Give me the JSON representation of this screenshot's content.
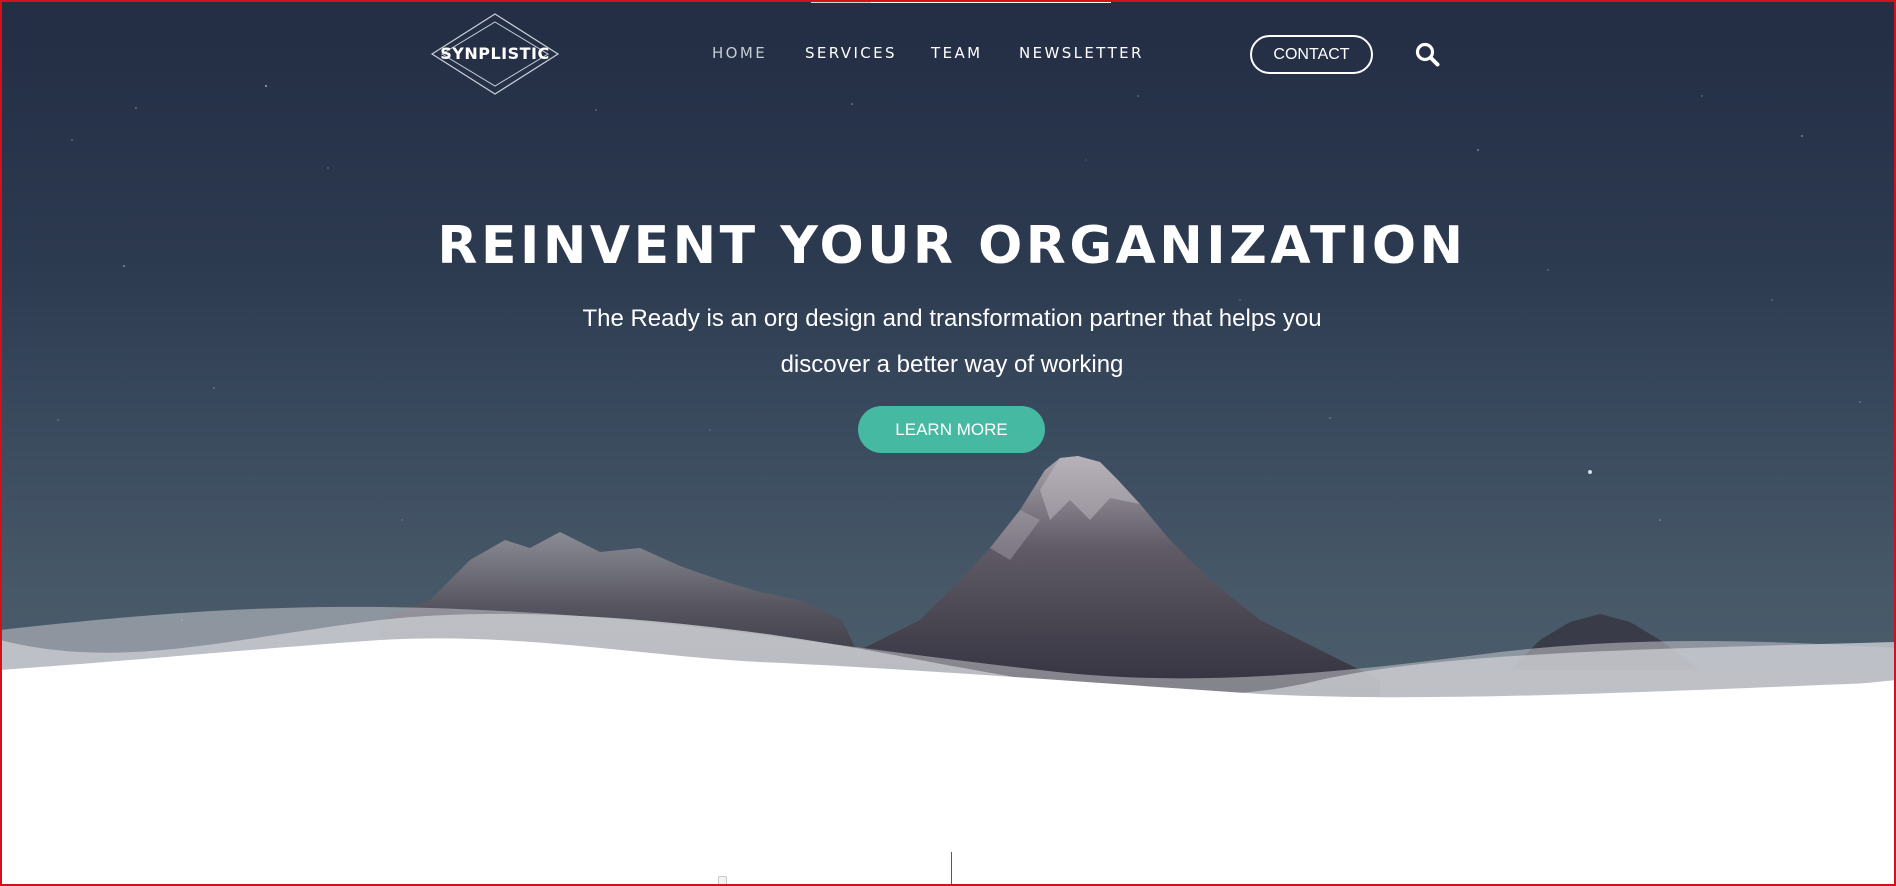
{
  "brand": {
    "name": "SYNPLISTIC"
  },
  "nav": {
    "items": [
      {
        "label": "HOME",
        "active": true
      },
      {
        "label": "SERVICES",
        "active": false
      },
      {
        "label": "TEAM",
        "active": false
      },
      {
        "label": "NEWSLETTER",
        "active": false
      }
    ]
  },
  "header": {
    "contact_label": "CONTACT",
    "search_icon": "search-icon"
  },
  "hero": {
    "title": "REINVENT YOUR ORGANIZATION",
    "subtitle_line1": "The Ready is an org design and transformation partner that helps you",
    "subtitle_line2": "discover a better way of working",
    "cta_label": "LEARN MORE"
  },
  "colors": {
    "accent": "#46b9a2",
    "sky_top": "#232d44",
    "sky_bottom": "#4d5e6c",
    "frame": "#d0121b"
  }
}
